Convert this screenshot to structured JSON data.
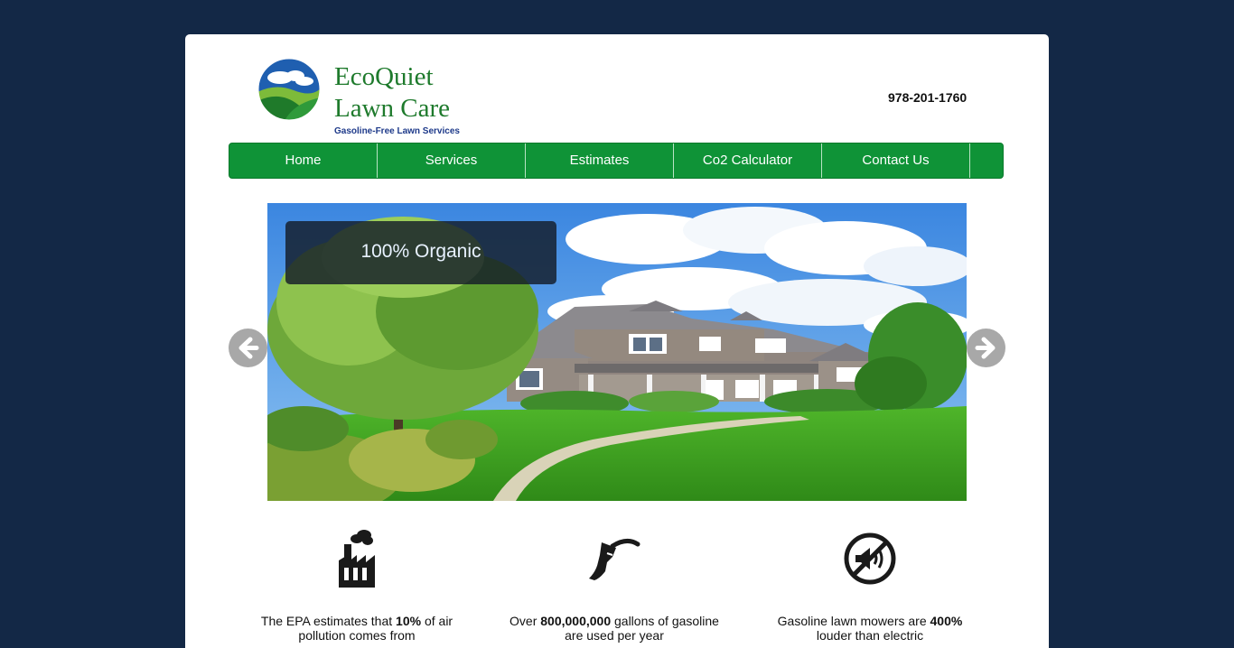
{
  "brand": {
    "line1": "EcoQuiet",
    "line2": "Lawn Care",
    "tagline": "Gasoline-Free Lawn Services",
    "logo": "eco-hills-logo"
  },
  "header": {
    "phone": "978-201-1760"
  },
  "nav": {
    "items": [
      {
        "label": "Home"
      },
      {
        "label": "Services"
      },
      {
        "label": "Estimates"
      },
      {
        "label": "Co2 Calculator"
      },
      {
        "label": "Contact Us"
      }
    ]
  },
  "slider": {
    "caption": "100% Organic",
    "prev_icon": "arrow-left-icon",
    "next_icon": "arrow-right-icon"
  },
  "features": [
    {
      "icon": "factory-icon",
      "text_before": "The EPA estimates that ",
      "bold": "10%",
      "text_after": " of air pollution comes from"
    },
    {
      "icon": "gas-pump-nozzle-icon",
      "text_before": "Over ",
      "bold": "800,000,000",
      "text_after": " gallons of gasoline are used per year"
    },
    {
      "icon": "no-noise-icon",
      "text_before": "Gasoline lawn mowers are ",
      "bold": "400%",
      "text_after": " louder than electric"
    }
  ],
  "colors": {
    "background": "#132846",
    "nav_green": "#0f9337",
    "brand_green": "#1e7a2c",
    "tagline_blue": "#1e3a8a"
  }
}
